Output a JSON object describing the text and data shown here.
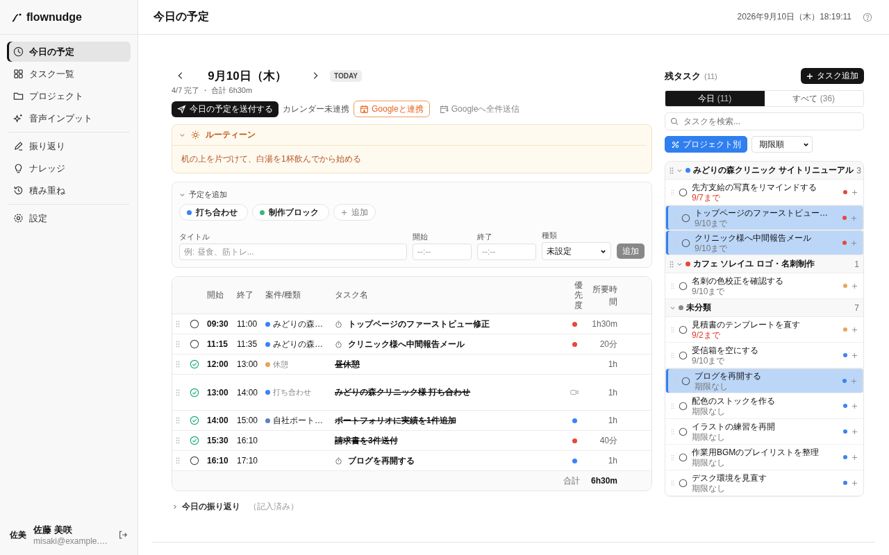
{
  "app": {
    "logo": "flownudge"
  },
  "sidebar": {
    "groups": [
      [
        {
          "label": "今日の予定",
          "selected": true
        },
        {
          "label": "タスク一覧",
          "selected": false
        },
        {
          "label": "プロジェクト",
          "selected": false
        },
        {
          "label": "音声インプット",
          "selected": false
        }
      ],
      [
        {
          "label": "振り返り",
          "selected": false
        },
        {
          "label": "ナレッジ",
          "selected": false
        },
        {
          "label": "積み重ね",
          "selected": false
        }
      ],
      [
        {
          "label": "設定",
          "selected": false
        }
      ]
    ],
    "user": {
      "avatar": "佐美",
      "name": "佐藤 美咲",
      "email": "misaki@example.…"
    }
  },
  "header": {
    "title": "今日の予定",
    "datetime": "2026年9月10日（木）18:19:11"
  },
  "day": {
    "date": "9月10日（木）",
    "badge": "TODAY",
    "summary": "4/7 完了 ・ 合計 6h30m"
  },
  "actions": {
    "send_button": "今日の予定を送付する",
    "calendar_status": "カレンダー未連携",
    "connect_button": "Googleと連携",
    "send_all_button": "Googleへ全件送信",
    "send_all_disabled": true
  },
  "routine": {
    "title": "ルーティーン",
    "expanded": true,
    "text": "机の上を片づけて、白湯を1杯飲んでから始める"
  },
  "add_form": {
    "heading": "予定を追加",
    "expanded": true,
    "presets": [
      {
        "label": "打ち合わせ",
        "color": "#3b82f6"
      },
      {
        "label": "制作ブロック",
        "color": "#3fb57a"
      }
    ],
    "add_preset": "追加",
    "title_label": "タイトル",
    "title_placeholder": "例: 昼食、筋トレ...",
    "start_label": "開始",
    "start_placeholder": "--:--",
    "end_label": "終了",
    "end_placeholder": "--:--",
    "type_label": "種類",
    "type_value": "未設定",
    "submit": "追加"
  },
  "schedule": {
    "columns": [
      "開始",
      "終了",
      "案件/種類",
      "タスク名",
      "優先度",
      "所要時間"
    ],
    "rows": [
      {
        "done": false,
        "start": "09:30",
        "end": "11:00",
        "category": {
          "kind": "project",
          "label": "みどりの森…",
          "color": "#3b82f6"
        },
        "timer": true,
        "title": "トップページのファーストビュー修正",
        "priority": {
          "kind": "dot",
          "color": "#e5483d"
        },
        "duration": "1h30m"
      },
      {
        "done": false,
        "start": "11:15",
        "end": "11:35",
        "category": {
          "kind": "project",
          "label": "みどりの森…",
          "color": "#3b82f6"
        },
        "timer": true,
        "title": "クリニック様へ中間報告メール",
        "priority": {
          "kind": "dot",
          "color": "#e5483d"
        },
        "duration": "20分"
      },
      {
        "done": true,
        "start": "12:00",
        "end": "13:00",
        "category": {
          "kind": "type",
          "label": "休憩",
          "color": "#e8a456"
        },
        "timer": false,
        "title": "昼休憩",
        "duration": "1h"
      },
      {
        "done": true,
        "start": "13:00",
        "end": "14:00",
        "category": {
          "kind": "type",
          "label": "打ち合わせ",
          "color": "#3b82f6"
        },
        "timer": false,
        "title": "みどりの森クリニック様 打ち合わせ",
        "priority": {
          "kind": "video"
        },
        "duration": "1h"
      },
      {
        "done": true,
        "start": "14:00",
        "end": "15:00",
        "category": {
          "kind": "project",
          "label": "自社ポート…",
          "color": "#5b7fc7"
        },
        "timer": false,
        "title": "ポートフォリオに実績を1件追加",
        "priority": {
          "kind": "dot",
          "color": "#3b82f6"
        },
        "duration": "1h"
      },
      {
        "done": true,
        "start": "15:30",
        "end": "16:10",
        "timer": false,
        "title": "請求書を3件送付",
        "priority": {
          "kind": "dot",
          "color": "#e5483d"
        },
        "duration": "40分"
      },
      {
        "done": false,
        "start": "16:10",
        "end": "17:10",
        "timer": true,
        "title": "ブログを再開する",
        "priority": {
          "kind": "dot",
          "color": "#3b82f6"
        },
        "duration": "1h"
      }
    ],
    "total_label": "合計",
    "total": "6h30m"
  },
  "reflection": {
    "label": "今日の振り返り",
    "note": "（記入済み）",
    "expanded": false
  },
  "tasks": {
    "title": "残タスク",
    "count": "(11)",
    "add_button": "タスク追加",
    "tabs": [
      {
        "label": "今日",
        "count": "(11)",
        "selected": true
      },
      {
        "label": "すべて",
        "count": "(36)",
        "selected": false
      }
    ],
    "search_placeholder": "タスクを検索...",
    "group_toggle": {
      "label": "プロジェクト別",
      "on": true
    },
    "sort": "期限順",
    "groups": [
      {
        "name": "みどりの森クリニック サイトリニューアル",
        "color": "#3b82f6",
        "count": "3",
        "expanded": true,
        "tasks": [
          {
            "title": "先方支給の写真をリマインドする",
            "due": "9/7まで",
            "overdue": true,
            "selected": false,
            "color": "#e5483d"
          },
          {
            "title": "トップページのファーストビュー…",
            "due": "9/10まで",
            "overdue": false,
            "selected": true,
            "color": "#e5483d"
          },
          {
            "title": "クリニック様へ中間報告メール",
            "due": "9/10まで",
            "overdue": false,
            "selected": true,
            "color": "#e5483d"
          }
        ]
      },
      {
        "name": "カフェ ソレイユ ロゴ・名刺制作",
        "color": "#e5483d",
        "count": "1",
        "expanded": true,
        "tasks": [
          {
            "title": "名刺の色校正を確認する",
            "due": "9/10まで",
            "overdue": false,
            "selected": false,
            "color": "#e8a456"
          }
        ]
      },
      {
        "name": "未分類",
        "color": "#888888",
        "count": "7",
        "expanded": true,
        "tasks": [
          {
            "title": "見積書のテンプレートを直す",
            "due": "9/2まで",
            "overdue": true,
            "selected": false,
            "color": "#e8a456"
          },
          {
            "title": "受信箱を空にする",
            "due": "9/10まで",
            "overdue": false,
            "selected": false,
            "color": "#3b82f6"
          },
          {
            "title": "ブログを再開する",
            "due": "期限なし",
            "overdue": false,
            "selected": true,
            "color": "#3b82f6"
          },
          {
            "title": "配色のストックを作る",
            "due": "期限なし",
            "overdue": false,
            "selected": false,
            "color": "#3b82f6"
          },
          {
            "title": "イラストの練習を再開",
            "due": "期限なし",
            "overdue": false,
            "selected": false,
            "color": "#3b82f6"
          },
          {
            "title": "作業用BGMのプレイリストを整理",
            "due": "期限なし",
            "overdue": false,
            "selected": false,
            "color": "#3b82f6"
          },
          {
            "title": "デスク環境を見直す",
            "due": "期限なし",
            "overdue": false,
            "selected": false,
            "color": "#3b82f6"
          }
        ]
      }
    ]
  }
}
